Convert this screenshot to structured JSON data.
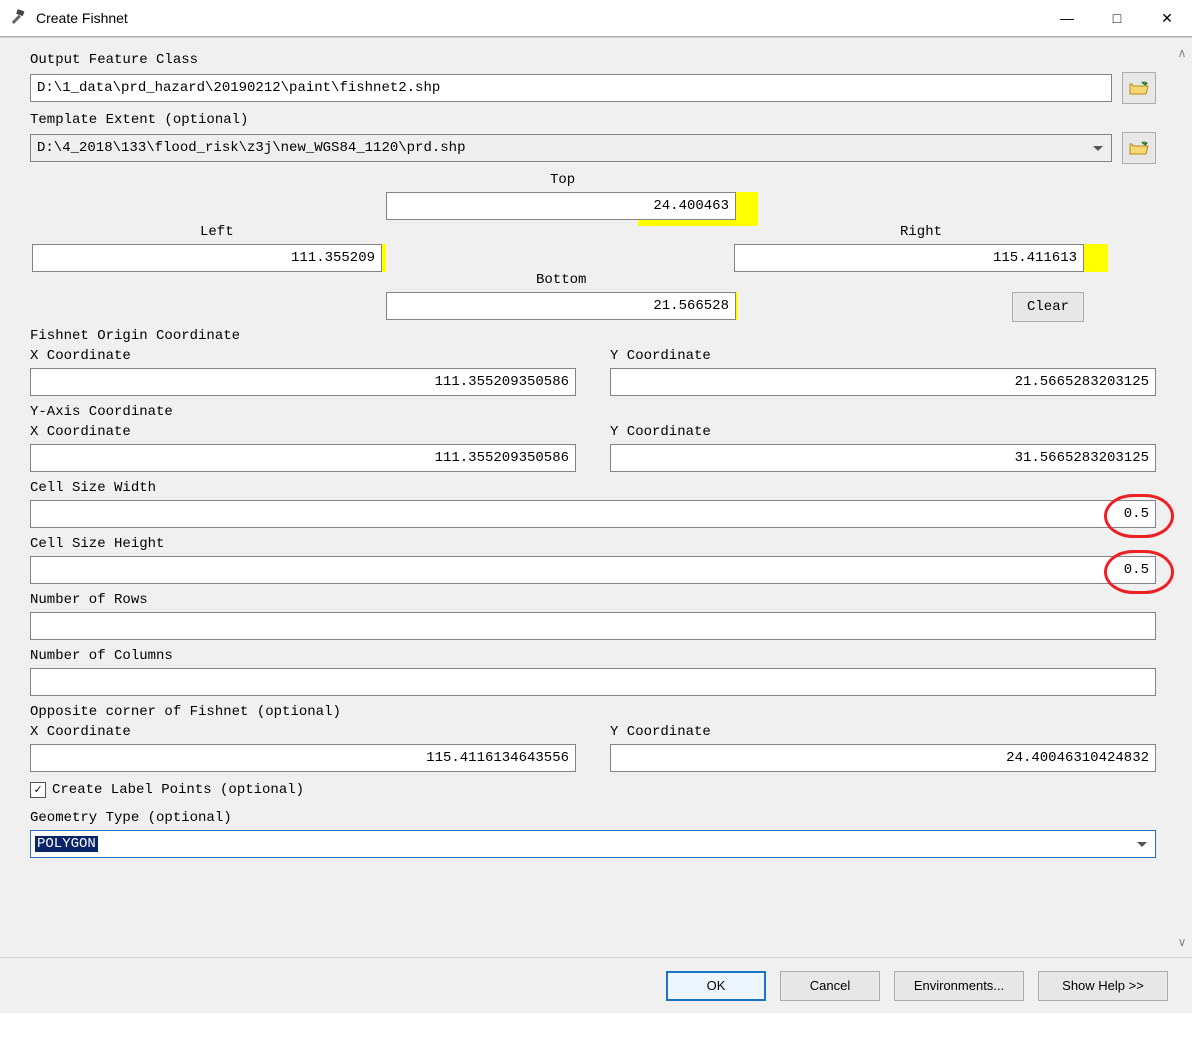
{
  "window": {
    "title": "Create Fishnet",
    "minimize": "—",
    "maximize": "□",
    "close": "✕"
  },
  "form": {
    "output_label": "Output Feature Class",
    "output_value": "D:\\1_data\\prd_hazard\\20190212\\paint\\fishnet2.shp",
    "template_label": "Template Extent (optional)",
    "template_value": "D:\\4_2018\\133\\flood_risk\\z3j\\new_WGS84_1120\\prd.shp",
    "extent": {
      "top_label": "Top",
      "top_value": "24.400463",
      "left_label": "Left",
      "left_value": "111.355209",
      "right_label": "Right",
      "right_value": "115.411613",
      "bottom_label": "Bottom",
      "bottom_value": "21.566528",
      "clear_label": "Clear"
    },
    "origin_label": "Fishnet Origin Coordinate",
    "xcoord_label": "X Coordinate",
    "ycoord_label": "Y Coordinate",
    "origin_x": "111.355209350586",
    "origin_y": "21.5665283203125",
    "yaxis_label": "Y-Axis Coordinate",
    "yaxis_x": "111.355209350586",
    "yaxis_y": "31.5665283203125",
    "cell_width_label": "Cell Size Width",
    "cell_width_value": "0.5",
    "cell_height_label": "Cell Size Height",
    "cell_height_value": "0.5",
    "rows_label": "Number of Rows",
    "rows_value": "",
    "cols_label": "Number of Columns",
    "cols_value": "",
    "opposite_label": "Opposite corner of Fishnet (optional)",
    "opposite_x": "115.4116134643556",
    "opposite_y": "24.40046310424832",
    "create_labels_label": "Create Label Points (optional)",
    "create_labels_checked": true,
    "geom_label": "Geometry Type (optional)",
    "geom_value": "POLYGON"
  },
  "buttons": {
    "ok": "OK",
    "cancel": "Cancel",
    "environments": "Environments...",
    "showhelp": "Show Help >>"
  }
}
